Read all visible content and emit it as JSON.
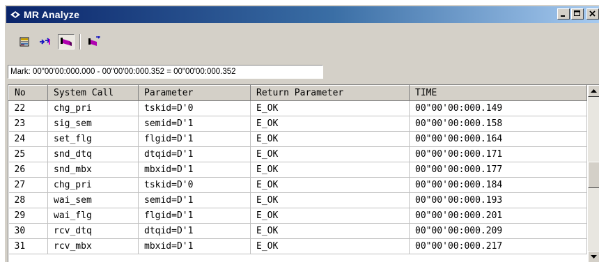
{
  "window": {
    "title": "MR Analyze",
    "icon": "diamond-app-icon",
    "buttons": [
      {
        "name": "minimize",
        "glyph": "_"
      },
      {
        "name": "maximize",
        "glyph": "□"
      },
      {
        "name": "close",
        "glyph": "×"
      }
    ]
  },
  "toolbar": {
    "buttons": [
      {
        "name": "list-view-icon",
        "pressed": false
      },
      {
        "name": "jump-arrows-icon",
        "pressed": false
      },
      {
        "name": "mark-task-icon",
        "pressed": true
      },
      {
        "name": "mark-range-icon",
        "pressed": false
      }
    ]
  },
  "markbar": {
    "text": "Mark: 00\"00'00:000.000 - 00\"00'00:000.352 = 00\"00'00:000.352"
  },
  "grid": {
    "columns": [
      "No",
      "System Call",
      "Parameter",
      "Return Parameter",
      "TIME"
    ],
    "rows": [
      {
        "no": "22",
        "call": "chg_pri",
        "param": "tskid=D'0",
        "ret": "E_OK",
        "time": "00\"00'00:000.149"
      },
      {
        "no": "23",
        "call": "sig_sem",
        "param": "semid=D'1",
        "ret": "E_OK",
        "time": "00\"00'00:000.158"
      },
      {
        "no": "24",
        "call": "set_flg",
        "param": "flgid=D'1",
        "ret": "E_OK",
        "time": "00\"00'00:000.164"
      },
      {
        "no": "25",
        "call": "snd_dtq",
        "param": "dtqid=D'1",
        "ret": "E_OK",
        "time": "00\"00'00:000.171"
      },
      {
        "no": "26",
        "call": "snd_mbx",
        "param": "mbxid=D'1",
        "ret": "E_OK",
        "time": "00\"00'00:000.177"
      },
      {
        "no": "27",
        "call": "chg_pri",
        "param": "tskid=D'0",
        "ret": "E_OK",
        "time": "00\"00'00:000.184"
      },
      {
        "no": "28",
        "call": "wai_sem",
        "param": "semid=D'1",
        "ret": "E_OK",
        "time": "00\"00'00:000.193"
      },
      {
        "no": "29",
        "call": "wai_flg",
        "param": "flgid=D'1",
        "ret": "E_OK",
        "time": "00\"00'00:000.201"
      },
      {
        "no": "30",
        "call": "rcv_dtq",
        "param": "dtqid=D'1",
        "ret": "E_OK",
        "time": "00\"00'00:000.209"
      },
      {
        "no": "31",
        "call": "rcv_mbx",
        "param": "mbxid=D'1",
        "ret": "E_OK",
        "time": "00\"00'00:000.217"
      }
    ]
  }
}
